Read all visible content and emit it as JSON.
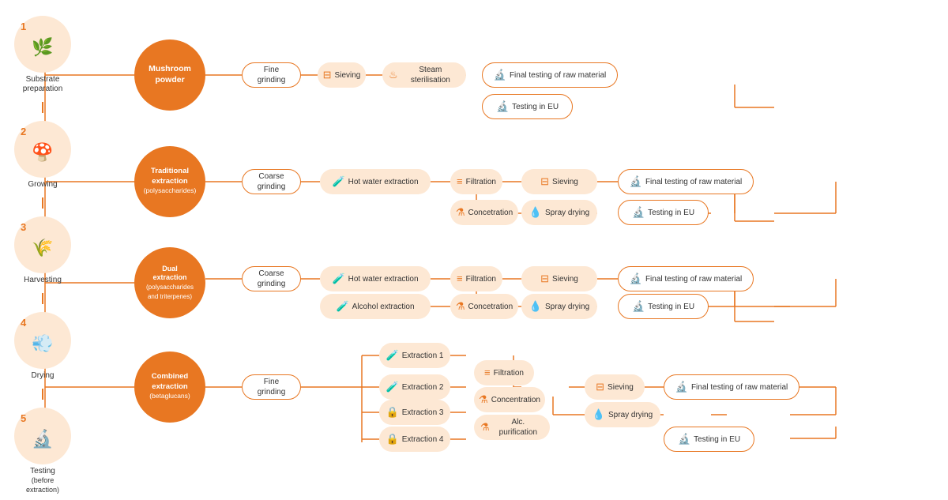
{
  "steps": [
    {
      "num": "1",
      "icon": "🌿",
      "label": "Substrate\npreparation"
    },
    {
      "num": "2",
      "icon": "🍄",
      "label": "Growing"
    },
    {
      "num": "3",
      "icon": "🌾",
      "label": "Harvesting"
    },
    {
      "num": "4",
      "icon": "💨",
      "label": "Drying"
    },
    {
      "num": "5",
      "icon": "🔬",
      "label": "Testing\n(before extraction)"
    }
  ],
  "processes": [
    {
      "id": "p1",
      "label": "Mushroom\npowder"
    },
    {
      "id": "p2",
      "label": "Traditional\nextraction\n(polysaccharides)"
    },
    {
      "id": "p3",
      "label": "Dual\nextraction\n(polysaccharides\nand triterpenes)"
    },
    {
      "id": "p4",
      "label": "Combined\nextraction\n(betaglucans)"
    }
  ],
  "boxes": {
    "fine_grinding_1": "Fine grinding",
    "sieving_1": "Sieving",
    "steam": "Steam sterilisation",
    "final_test_1": "Final testing of raw material",
    "testing_eu_1": "Testing in EU",
    "coarse_grinding_2": "Coarse grinding",
    "hot_water_2": "Hot water extraction",
    "filtration_2": "Filtration",
    "concentration_2": "Concetration",
    "sieving_2": "Sieving",
    "spray_drying_2": "Spray drying",
    "final_test_2": "Final testing of raw material",
    "testing_eu_2": "Testing in EU",
    "coarse_grinding_3": "Coarse grinding",
    "hot_water_3": "Hot water extraction",
    "alcohol_3": "Alcohol extraction",
    "filtration_3": "Filtration",
    "concentration_3": "Concetration",
    "sieving_3": "Sieving",
    "spray_drying_3": "Spray drying",
    "final_test_3": "Final testing of raw material",
    "testing_eu_3": "Testing in EU",
    "fine_grinding_4": "Fine grinding",
    "extraction1_4": "Extraction 1",
    "extraction2_4": "Extraction 2",
    "extraction3_4": "Extraction 3",
    "extraction4_4": "Extraction 4",
    "filtration_4": "Filtration",
    "concentration_4": "Concentration",
    "alc_purification_4": "Alc. purification",
    "sieving_4": "Sieving",
    "spray_drying_4": "Spray drying",
    "final_test_4": "Final testing of raw material",
    "testing_eu_4": "Testing in EU"
  }
}
